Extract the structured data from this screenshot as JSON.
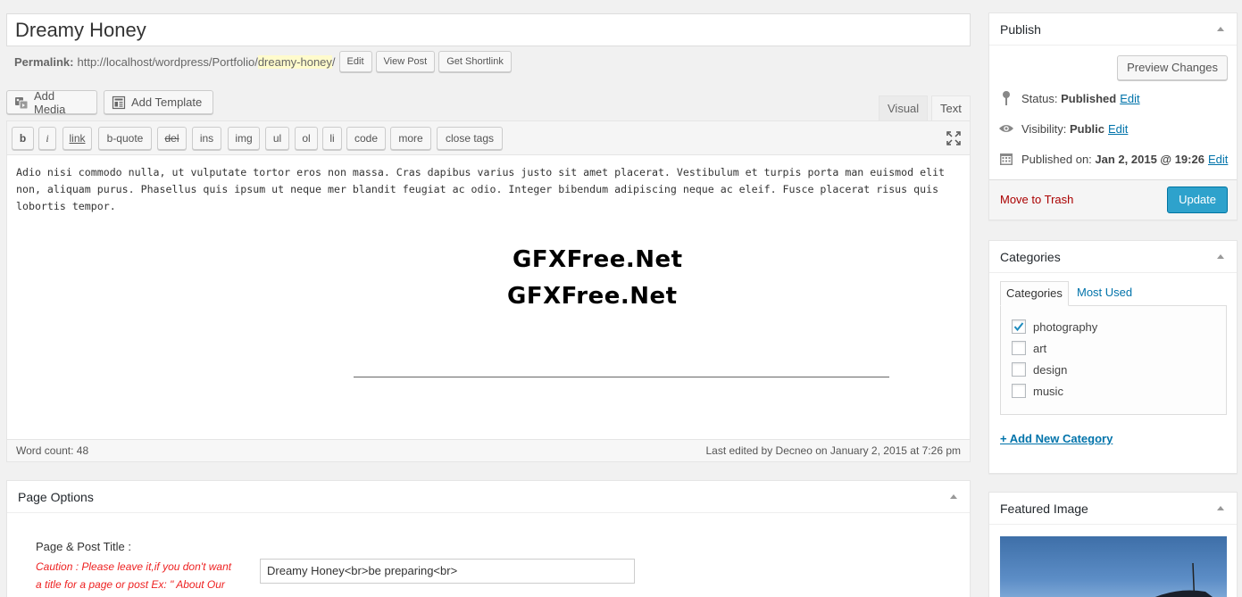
{
  "post": {
    "title": "Dreamy Honey",
    "permalink_label": "Permalink:",
    "permalink_base": "http://localhost/wordpress/Portfolio/",
    "permalink_slug": "dreamy-honey",
    "permalink_end": "/",
    "edit_btn": "Edit",
    "view_btn": "View Post",
    "shortlink_btn": "Get Shortlink"
  },
  "media": {
    "add_media": "Add Media",
    "add_template": "Add Template"
  },
  "editor_tabs": {
    "visual": "Visual",
    "text": "Text"
  },
  "quicktags": [
    "b",
    "i",
    "link",
    "b-quote",
    "del",
    "ins",
    "img",
    "ul",
    "ol",
    "li",
    "code",
    "more",
    "close tags"
  ],
  "content": {
    "text": "Adio nisi commodo nulla, ut vulputate tortor eros non massa. Cras dapibus varius justo sit amet placerat. Vestibulum et turpis porta man euismod elit non, aliquam purus. Phasellus quis ipsum ut neque mer blandit feugiat ac odio. Integer bibendum adipiscing neque ac eleif. Fusce placerat risus quis lobortis tempor.",
    "watermark1": "GFXFree.Net",
    "watermark2": "GFXFree.Net"
  },
  "status_bar": {
    "word_count": "Word count: 48",
    "last_edited": "Last edited by Decneo on January 2, 2015 at 7:26 pm"
  },
  "page_options": {
    "title": "Page Options",
    "field_label": "Page & Post Title :",
    "caution": "Caution : Please leave it,if you don't want a title for a page or post Ex: \" About Our Company\"",
    "field_value": "Dreamy Honey<br>be preparing<br>"
  },
  "publish": {
    "title": "Publish",
    "preview_btn": "Preview Changes",
    "status_label": "Status:",
    "status_value": "Published",
    "visibility_label": "Visibility:",
    "visibility_value": "Public",
    "published_label": "Published on:",
    "published_value": "Jan 2, 2015 @ 19:26",
    "edit_link": "Edit",
    "trash": "Move to Trash",
    "update_btn": "Update"
  },
  "categories": {
    "title": "Categories",
    "tab_all": "Categories",
    "tab_used": "Most Used",
    "items": [
      {
        "label": "photography",
        "checked": true
      },
      {
        "label": "art",
        "checked": false
      },
      {
        "label": "design",
        "checked": false
      },
      {
        "label": "music",
        "checked": false
      }
    ],
    "add_new": "+ Add New Category"
  },
  "featured_image": {
    "title": "Featured Image"
  },
  "colors": {
    "accent": "#2ea2cc",
    "link": "#0073aa",
    "trash": "#aa0000",
    "caution": "#ee2222"
  }
}
